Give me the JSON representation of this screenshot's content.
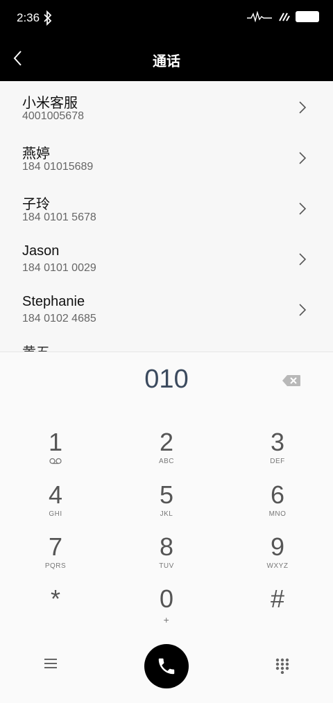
{
  "status": {
    "time": "2:36"
  },
  "header": {
    "title": "通话"
  },
  "contacts": [
    {
      "name": "小米客服",
      "number": "4001005678"
    },
    {
      "name": "燕婷",
      "number": "184 01015689"
    },
    {
      "name": "子玲",
      "number": "184 0101 5678"
    },
    {
      "name": "Jason",
      "number": "184 0101 0029"
    },
    {
      "name": "Stephanie",
      "number": "184 0102 4685"
    },
    {
      "name": "黄五",
      "number": ""
    }
  ],
  "dialpad": {
    "entered": "010",
    "keys": [
      {
        "num": "1",
        "sub": ""
      },
      {
        "num": "2",
        "sub": "ABC"
      },
      {
        "num": "3",
        "sub": "DEF"
      },
      {
        "num": "4",
        "sub": "GHI"
      },
      {
        "num": "5",
        "sub": "JKL"
      },
      {
        "num": "6",
        "sub": "MNO"
      },
      {
        "num": "7",
        "sub": "PQRS"
      },
      {
        "num": "8",
        "sub": "TUV"
      },
      {
        "num": "9",
        "sub": "WXYZ"
      },
      {
        "num": "*",
        "sub": ""
      },
      {
        "num": "0",
        "sub": "+"
      },
      {
        "num": "#",
        "sub": ""
      }
    ]
  },
  "icons": {
    "back": "chevron-left-icon",
    "row": "chevron-right-icon",
    "bluetooth": "bluetooth-icon",
    "signal": "signal-icon",
    "battery": "battery-icon",
    "voicemail": "voicemail-icon",
    "backspace": "backspace-icon",
    "menu": "menu-icon",
    "call": "phone-icon",
    "keypad": "keypad-icon"
  }
}
